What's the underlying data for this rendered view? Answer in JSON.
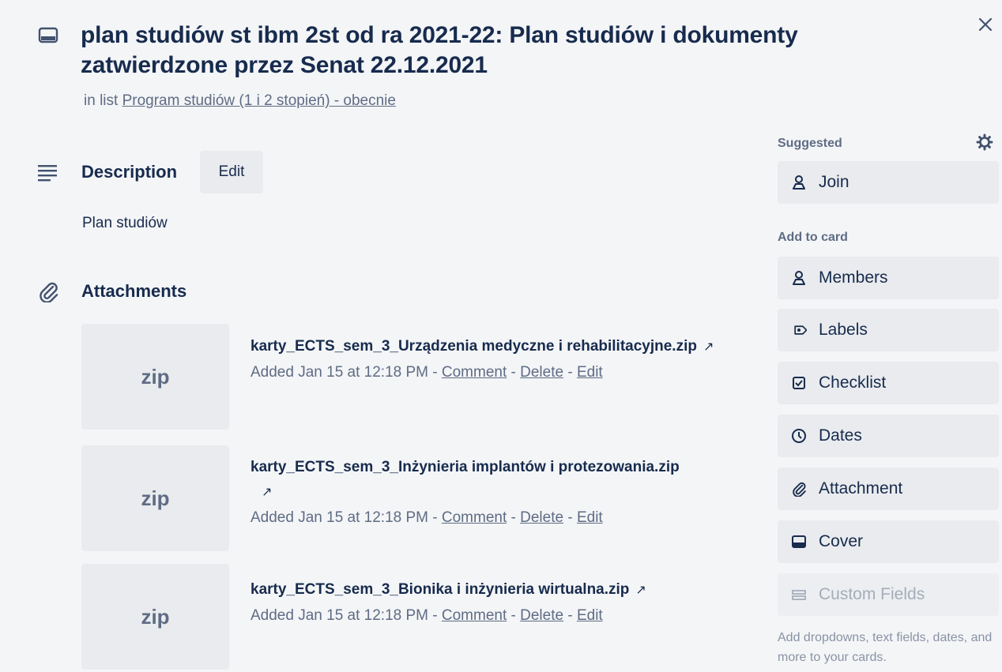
{
  "card": {
    "title": "plan studiów st ibm 2st od ra 2021-22: Plan studiów i dokumenty zatwierdzone przez Senat 22.12.2021",
    "in_list_prefix": "in list",
    "list_name": "Program studiów (1 i 2 stopień) - obecnie"
  },
  "description": {
    "title": "Description",
    "edit_label": "Edit",
    "text": "Plan studiów"
  },
  "attachments": {
    "title": "Attachments",
    "items": [
      {
        "thumb": "zip",
        "name": "karty_ECTS_sem_3_Urządzenia medyczne i rehabilitacyjne.zip",
        "arrow": "↗",
        "added": "Added Jan 15 at 12:18 PM",
        "comment": "Comment",
        "delete": "Delete",
        "edit": "Edit"
      },
      {
        "thumb": "zip",
        "name": "karty_ECTS_sem_3_Inżynieria implantów i protezowania.zip",
        "arrow": "↗",
        "added": "Added Jan 15 at 12:18 PM",
        "comment": "Comment",
        "delete": "Delete",
        "edit": "Edit"
      },
      {
        "thumb": "zip",
        "name": "karty_ECTS_sem_3_Bionika i inżynieria wirtualna.zip",
        "arrow": "↗",
        "added": "Added Jan 15 at 12:18 PM",
        "comment": "Comment",
        "delete": "Delete",
        "edit": "Edit"
      }
    ]
  },
  "sidebar": {
    "suggested_heading": "Suggested",
    "join_label": "Join",
    "add_to_card_heading": "Add to card",
    "buttons": [
      {
        "label": "Members",
        "icon": "person-icon"
      },
      {
        "label": "Labels",
        "icon": "tag-icon"
      },
      {
        "label": "Checklist",
        "icon": "checkbox-icon"
      },
      {
        "label": "Dates",
        "icon": "clock-icon"
      },
      {
        "label": "Attachment",
        "icon": "paperclip-icon"
      },
      {
        "label": "Cover",
        "icon": "cover-icon"
      },
      {
        "label": "Custom Fields",
        "icon": "custom-fields-icon"
      }
    ],
    "custom_fields_note": "Add dropdowns, text fields, dates, and more to your cards."
  },
  "colors": {
    "background": "#f4f5f7",
    "button": "#e9ebee",
    "text": "#172b4d",
    "muted": "#5e6c84"
  }
}
